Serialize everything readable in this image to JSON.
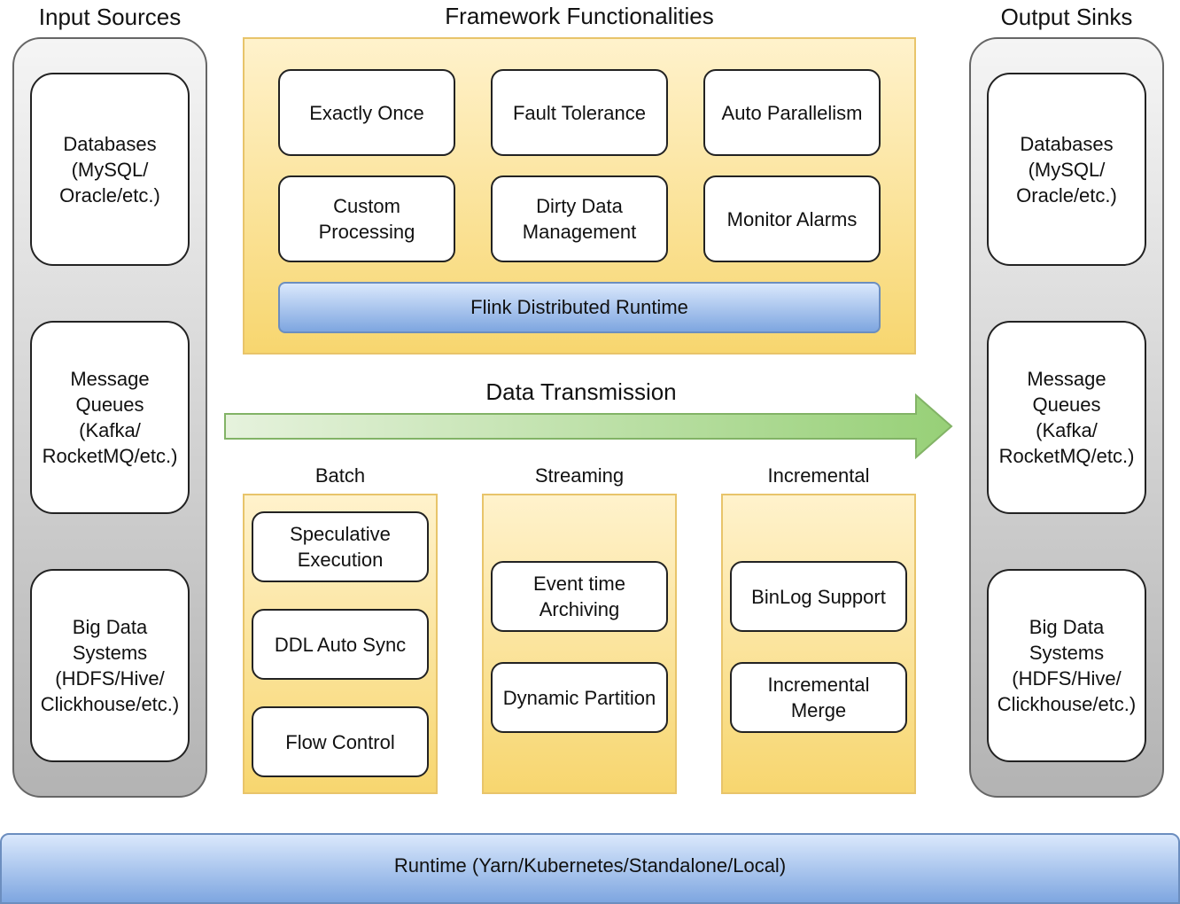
{
  "input_sources": {
    "title": "Input Sources",
    "items": [
      "Databases\n(MySQL/\nOracle/etc.)",
      "Message\nQueues\n(Kafka/\nRocketMQ/etc.)",
      "Big Data\nSystems\n(HDFS/Hive/\nClickhouse/etc.)"
    ]
  },
  "output_sinks": {
    "title": "Output Sinks",
    "items": [
      "Databases\n(MySQL/\nOracle/etc.)",
      "Message\nQueues\n(Kafka/\nRocketMQ/etc.)",
      "Big Data\nSystems\n(HDFS/Hive/\nClickhouse/etc.)"
    ]
  },
  "framework": {
    "title": "Framework Functionalities",
    "features": [
      "Exactly Once",
      "Fault Tolerance",
      "Auto Parallelism",
      "Custom\nProcessing",
      "Dirty Data\nManagement",
      "Monitor Alarms"
    ],
    "runtime": "Flink Distributed Runtime"
  },
  "transmission": {
    "label": "Data Transmission"
  },
  "modes": [
    {
      "title": "Batch",
      "items": [
        "Speculative\nExecution",
        "DDL Auto Sync",
        "Flow Control"
      ]
    },
    {
      "title": "Streaming",
      "items": [
        "Event time\nArchiving",
        "Dynamic Partition"
      ]
    },
    {
      "title": "Incremental",
      "items": [
        "BinLog Support",
        "Incremental\nMerge"
      ]
    }
  ],
  "runtime": {
    "label": "Runtime (Yarn/Kubernetes/Standalone/Local)"
  },
  "colors": {
    "gray": "#b3b3b3",
    "yellow": "#f7d66f",
    "blue": "#7ea6e0",
    "green": "#97d077"
  }
}
